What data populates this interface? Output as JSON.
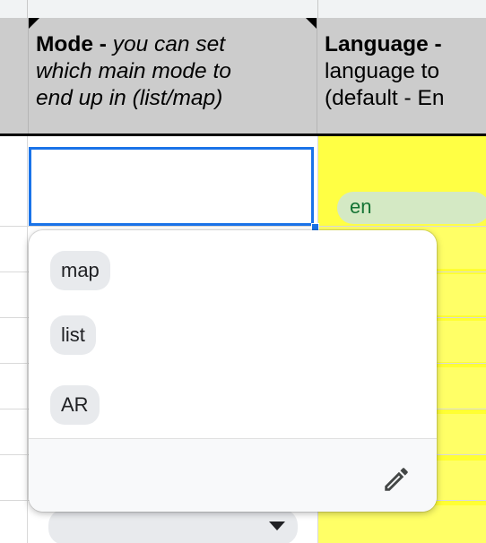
{
  "headers": {
    "mode": {
      "bold": "Mode - ",
      "italic_line1": "you can set",
      "italic_line2": "which main mode to",
      "italic_line3": "end up in (list/map)"
    },
    "language": {
      "bold": "Language -",
      "line2": "language to",
      "line3": "(default - En"
    }
  },
  "cells": {
    "language_value": "en",
    "mode_value": ""
  },
  "dropdown": {
    "options": [
      "map",
      "list",
      "AR"
    ],
    "edit_icon": "pencil-icon"
  },
  "colors": {
    "active_border": "#1a73e8",
    "highlight": "#ffff66",
    "chip_green": "#d4e9c4",
    "chip_grey": "#e8eaed"
  }
}
